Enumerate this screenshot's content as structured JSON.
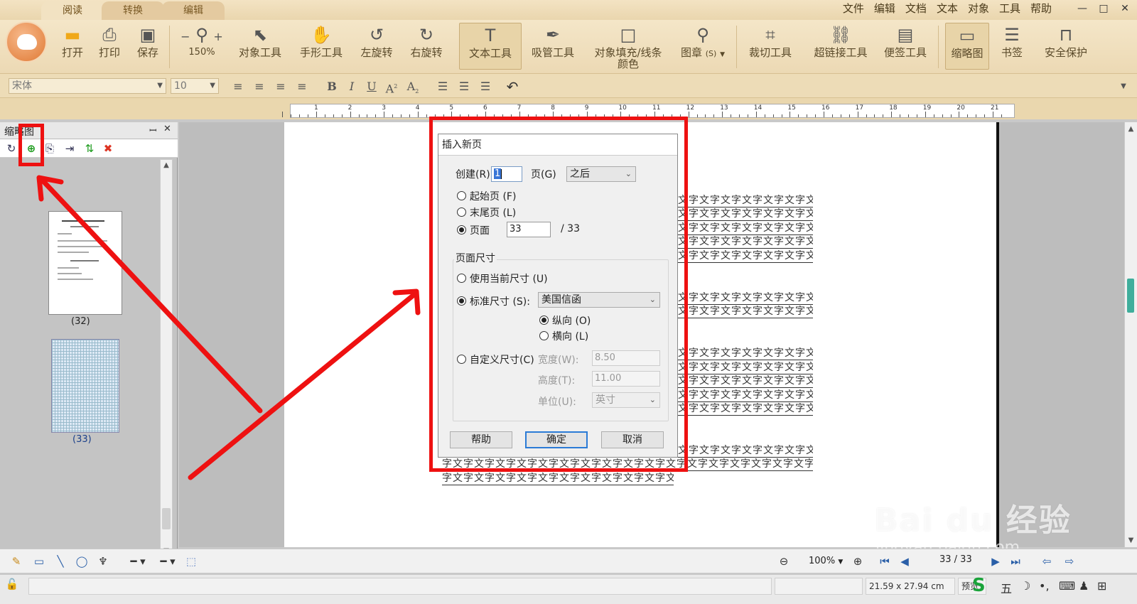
{
  "tabs": [
    "阅读",
    "转换",
    "编辑"
  ],
  "menu": [
    "文件",
    "编辑",
    "文档",
    "文本",
    "对象",
    "工具",
    "帮助"
  ],
  "window_controls": [
    "—",
    "□",
    "✕"
  ],
  "ribbon": {
    "open": "打开",
    "print": "打印",
    "save": "保存",
    "zoom_level": "150%",
    "object_tool": "对象工具",
    "hand_tool": "手形工具",
    "rotate_left": "左旋转",
    "rotate_right": "右旋转",
    "text_tool": "文本工具",
    "eyedropper_tool": "吸管工具",
    "fill_stroke_color_1": "对象填充/线条",
    "fill_stroke_color_2": "颜色",
    "stamp": "图章",
    "stamp_key": "(S)",
    "crop_tool": "裁切工具",
    "hyperlink_tool": "超链接工具",
    "note_tool": "便签工具",
    "thumbnail": "缩略图",
    "bookmark": "书签",
    "security": "安全保护"
  },
  "format": {
    "font": "宋体",
    "size": "10",
    "bold": "B",
    "italic": "I",
    "underline": "U",
    "superscript": "A",
    "superscript_mark": "2",
    "subscript": "A",
    "subscript_mark": "2"
  },
  "ruler_labels": [
    "1",
    "2",
    "3",
    "4",
    "5",
    "6",
    "7",
    "8",
    "9",
    "10",
    "11",
    "12",
    "13",
    "14",
    "15",
    "16",
    "17",
    "18",
    "19",
    "20",
    "21"
  ],
  "left_panel": {
    "title": "缩略图",
    "pin": "ꟷ",
    "close": "✕",
    "thumb_labels": [
      "(32)",
      "(33)"
    ]
  },
  "doc_text": {
    "block_line": "文字文字文字文字文字文字文字",
    "last_line_a": "字文字文字文字文字文字文字文字文字文字文字文字文字文字文字文字文字文字文字文",
    "last_line_b": "字文字文字文字文字文字文字文字文字文字文字文字。"
  },
  "dialog": {
    "title": "插入新页",
    "create_label": "创建(R):",
    "create_value": "1",
    "page_label": "页(G)",
    "position_value": "之后",
    "first_page": "起始页 (F)",
    "last_page": "末尾页 (L)",
    "page_option": "页面",
    "page_value": "33",
    "page_total": "/  33",
    "page_size_group": "页面尺寸",
    "use_current_size": "使用当前尺寸 (U)",
    "standard_size": "标准尺寸 (S):",
    "standard_size_value": "美国信函",
    "portrait": "纵向 (O)",
    "landscape": "横向 (L)",
    "custom_size": "自定义尺寸(C)",
    "width_label": "宽度(W):",
    "width_value": "8.50",
    "height_label": "高度(T):",
    "height_value": "11.00",
    "unit_label": "单位(U):",
    "unit_value": "英寸",
    "help": "帮助",
    "ok": "确定",
    "cancel": "取消"
  },
  "bottom": {
    "zoom": "100%",
    "page_indicator": "33 / 33",
    "page_dimensions": "21.59 x 27.94 cm",
    "preview": "预览"
  },
  "ime": {
    "brand": "S",
    "mode": "五"
  },
  "watermark": {
    "main": "Bai du 经验",
    "sub": "jingyan.baidu.com"
  },
  "colors": {
    "ribbon_bg": "#f4e6c8",
    "annotation_red": "#ee1111",
    "dialog_bg": "#f0f0f0",
    "default_button": "#2b7bd6"
  }
}
